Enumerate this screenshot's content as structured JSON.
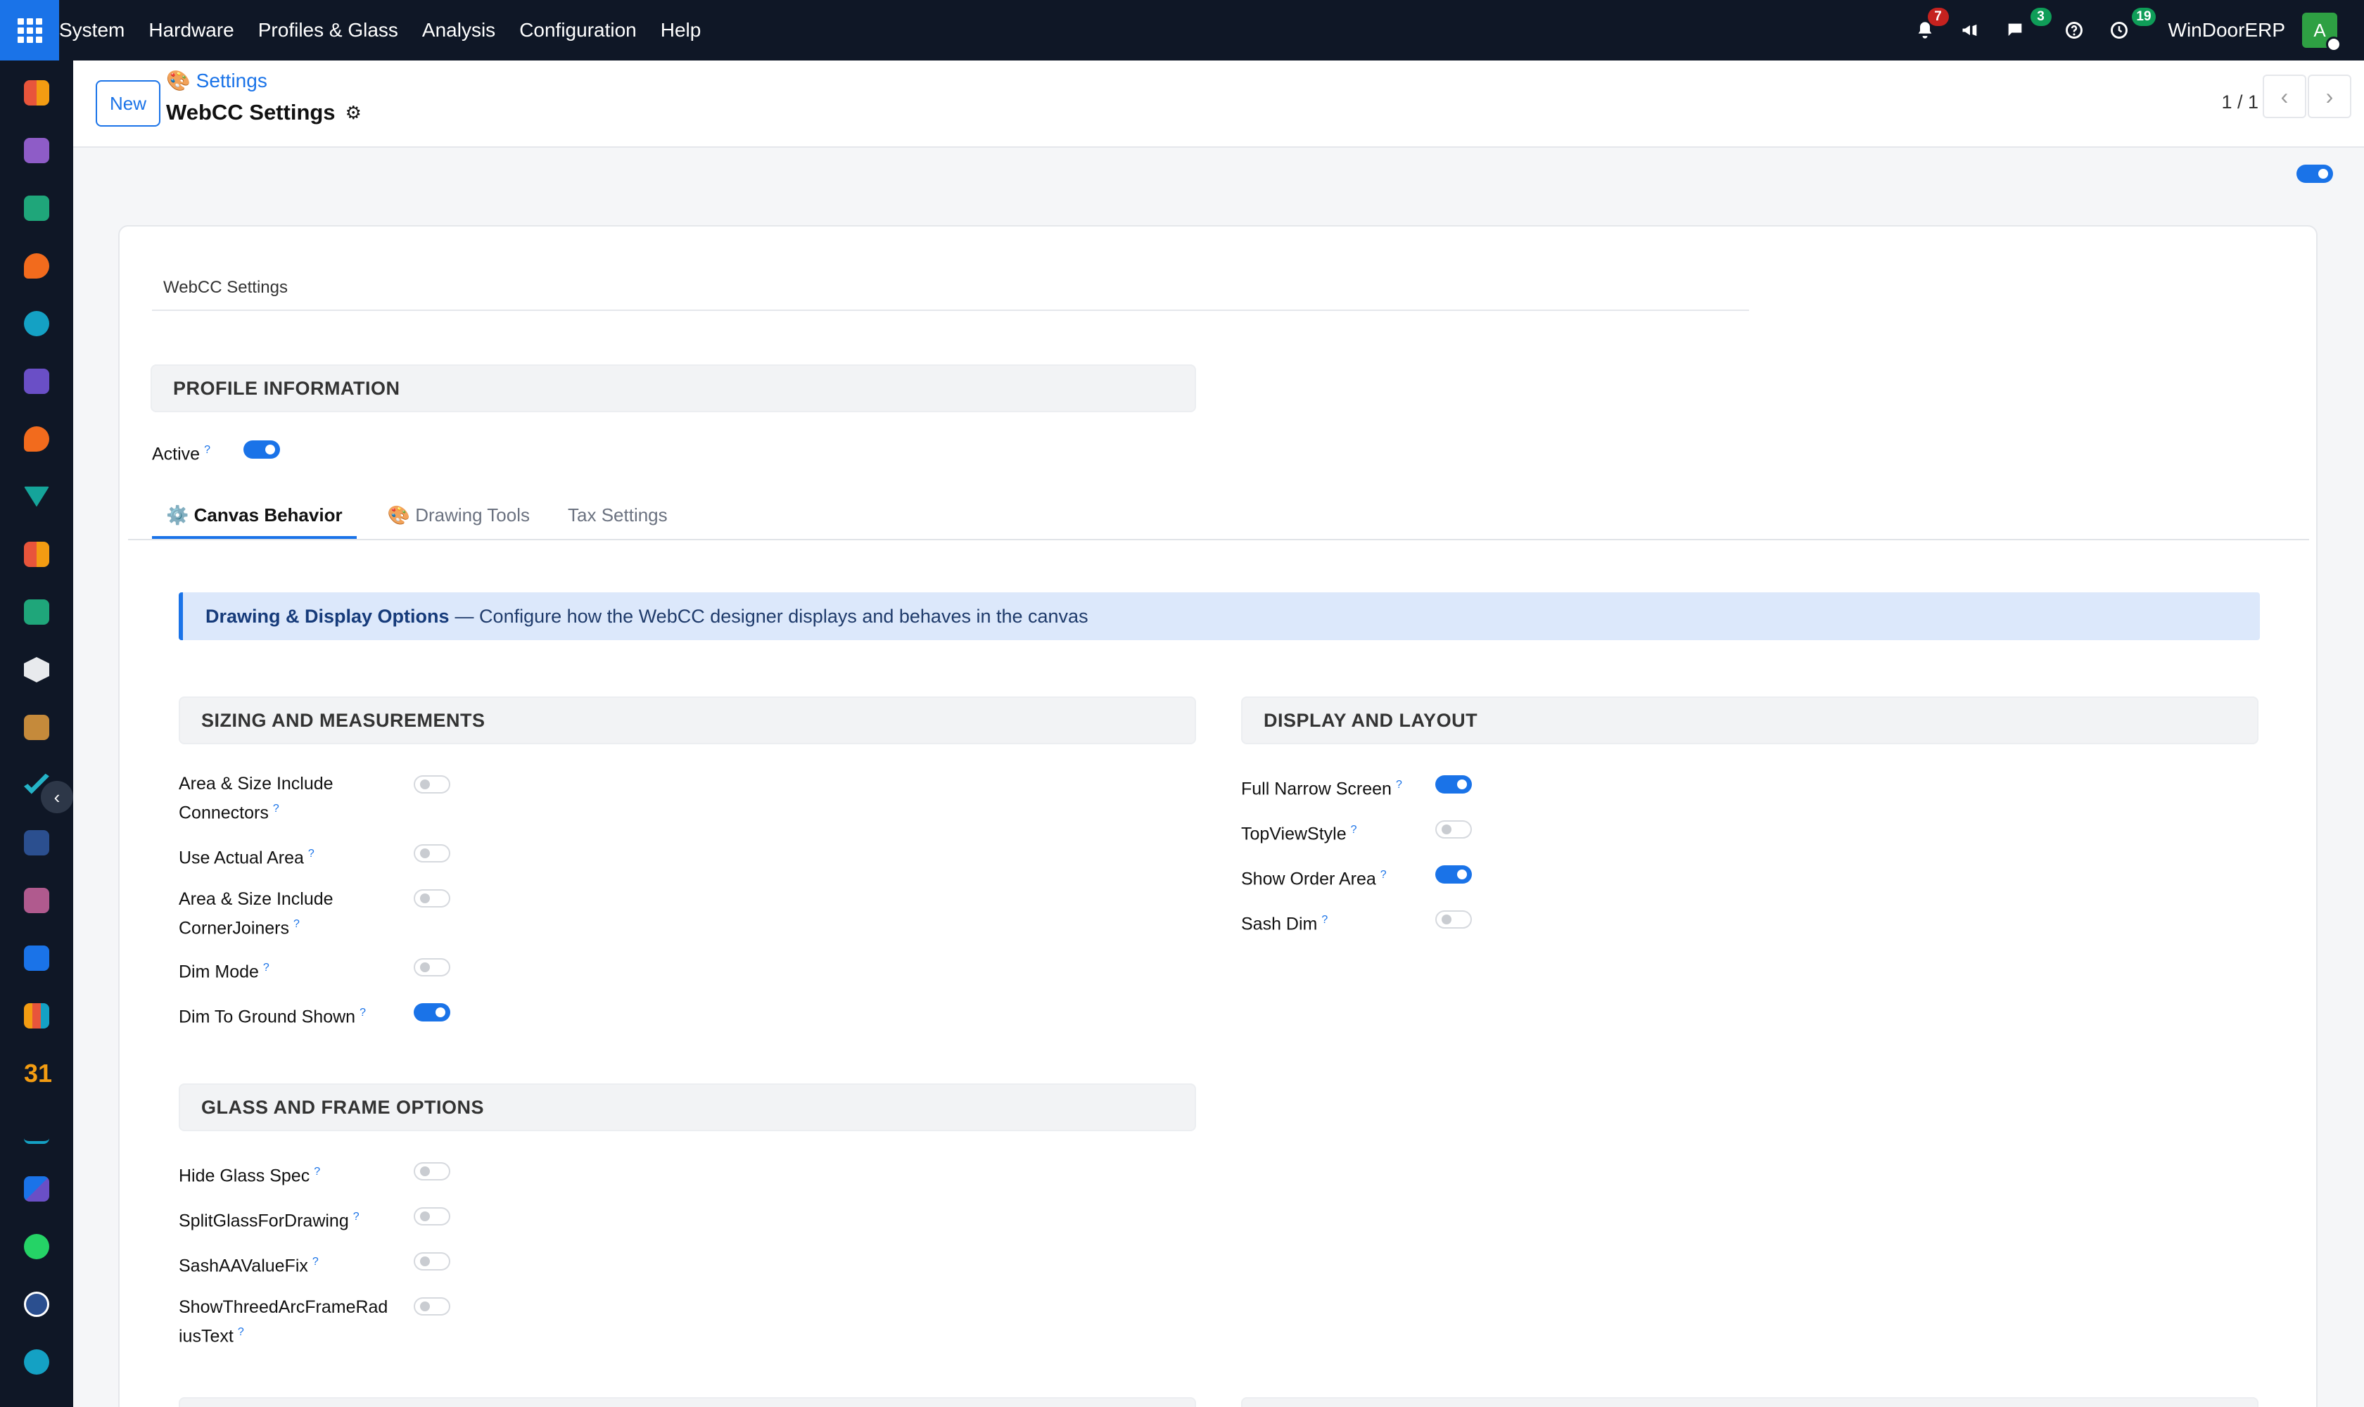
{
  "topbar": {
    "menu": [
      "System",
      "Hardware",
      "Profiles & Glass",
      "Analysis",
      "Configuration",
      "Help"
    ],
    "notifications_count": "7",
    "messages_count": "3",
    "activities_count": "19",
    "company": "WinDoorERP",
    "avatar_letter": "A"
  },
  "control": {
    "new_label": "New",
    "breadcrumb": "🎨 Settings",
    "title": "WebCC Settings",
    "gear": "⚙",
    "pager": "1 / 1",
    "prev": "‹",
    "next": "›"
  },
  "sheet": {
    "name_value": "WebCC Settings",
    "profile_section": "PROFILE INFORMATION",
    "active_label": "Active",
    "active_on": true,
    "tabs": [
      {
        "label": "⚙️ Canvas Behavior"
      },
      {
        "label": "🎨 Drawing Tools"
      },
      {
        "label": "Tax Settings"
      }
    ],
    "banner_title": "Drawing & Display Options",
    "banner_text": "— Configure how the WebCC designer displays and behaves in the canvas",
    "sizing": {
      "title": "SIZING AND MEASUREMENTS",
      "fields": [
        {
          "label": "Area & Size Include Connectors",
          "on": false
        },
        {
          "label": "Use Actual Area",
          "on": false
        },
        {
          "label": "Area & Size Include CornerJoiners",
          "on": false
        },
        {
          "label": "Dim Mode",
          "on": false
        },
        {
          "label": "Dim To Ground Shown",
          "on": true
        }
      ]
    },
    "display": {
      "title": "DISPLAY AND LAYOUT",
      "fields": [
        {
          "label": "Full Narrow Screen",
          "on": true
        },
        {
          "label": "TopViewStyle",
          "on": false
        },
        {
          "label": "Show Order Area",
          "on": true
        },
        {
          "label": "Sash Dim",
          "on": false
        }
      ]
    },
    "glass": {
      "title": "GLASS AND FRAME OPTIONS",
      "fields": [
        {
          "label": "Hide Glass Spec",
          "on": false
        },
        {
          "label": "SplitGlassForDrawing",
          "on": false
        },
        {
          "label": "SashAAValueFix",
          "on": false
        },
        {
          "label": "ShowThreedArcFrameRadiusText",
          "on": false
        }
      ]
    },
    "help_mark": "?"
  },
  "colors": {
    "accent": "#1a73e8",
    "topbar": "#0f1726",
    "banner": "#dce8fb",
    "badge_red": "#c5221f",
    "badge_green": "#0f9d58"
  }
}
